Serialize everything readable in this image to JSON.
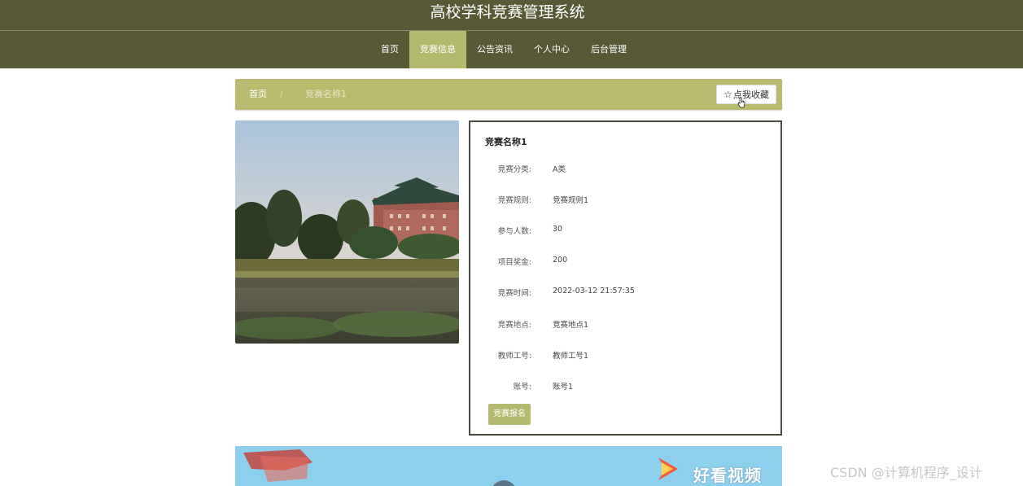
{
  "site": {
    "title": "高校学科竞赛管理系统"
  },
  "nav": {
    "items": [
      {
        "label": "首页",
        "active": false
      },
      {
        "label": "竞赛信息",
        "active": true
      },
      {
        "label": "公告资讯",
        "active": false
      },
      {
        "label": "个人中心",
        "active": false
      },
      {
        "label": "后台管理",
        "active": false
      }
    ]
  },
  "breadcrumb": {
    "home": "首页",
    "separator": "/",
    "current": "竞赛名称1"
  },
  "favorite_button": {
    "label": "点我收藏",
    "icon": "star-outline-icon"
  },
  "detail": {
    "title": "竞赛名称1",
    "fields": [
      {
        "label": "竞赛分类:",
        "value": "A类"
      },
      {
        "label": "竞赛规则:",
        "value": "竞赛规则1"
      },
      {
        "label": "参与人数:",
        "value": "30"
      },
      {
        "label": "项目奖金:",
        "value": "200"
      },
      {
        "label": "竞赛时间:",
        "value": "2022-03-12 21:57:35"
      },
      {
        "label": "竞赛地点:",
        "value": "竞赛地点1"
      },
      {
        "label": "教师工号:",
        "value": "教师工号1"
      },
      {
        "label": "账号:",
        "value": "账号1"
      }
    ],
    "signup_button": "竞赛报名"
  },
  "video_strip": {
    "logo_text": "好看视频"
  },
  "watermark": "CSDN @计算机程序_设计",
  "colors": {
    "header_bg": "#585a36",
    "accent": "#b3b96e",
    "breadcrumb_bg": "#b9bb6f"
  }
}
